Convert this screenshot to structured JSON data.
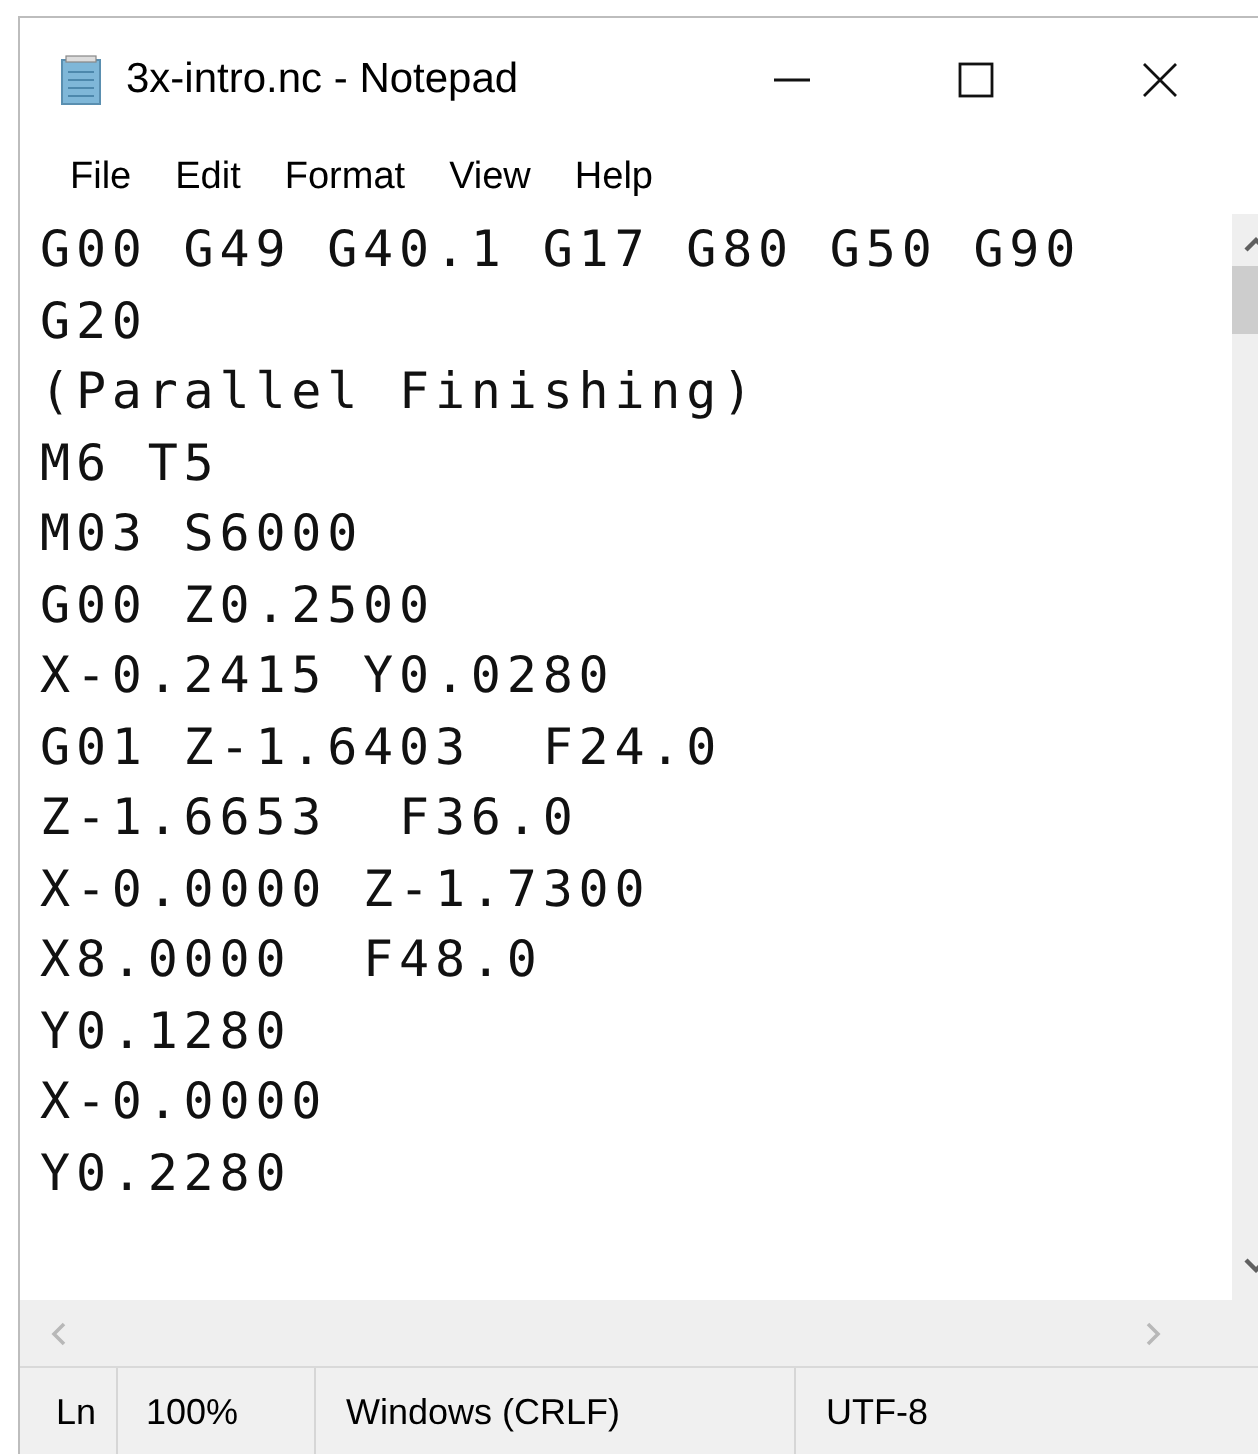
{
  "window": {
    "title": "3x-intro.nc - Notepad"
  },
  "menu": [
    "File",
    "Edit",
    "Format",
    "View",
    "Help"
  ],
  "editor": {
    "lines": [
      "G00 G49 G40.1 G17 G80 G50 G90",
      "G20",
      "(Parallel Finishing)",
      "M6 T5",
      "M03 S6000",
      "G00 Z0.2500",
      "X-0.2415 Y0.0280",
      "G01 Z-1.6403  F24.0",
      "Z-1.6653  F36.0",
      "X-0.0000 Z-1.7300",
      "X8.0000  F48.0",
      "Y0.1280",
      "X-0.0000",
      "Y0.2280"
    ]
  },
  "status_bar": [
    "Ln",
    "100%",
    "Windows (CRLF)",
    "UTF-8"
  ]
}
